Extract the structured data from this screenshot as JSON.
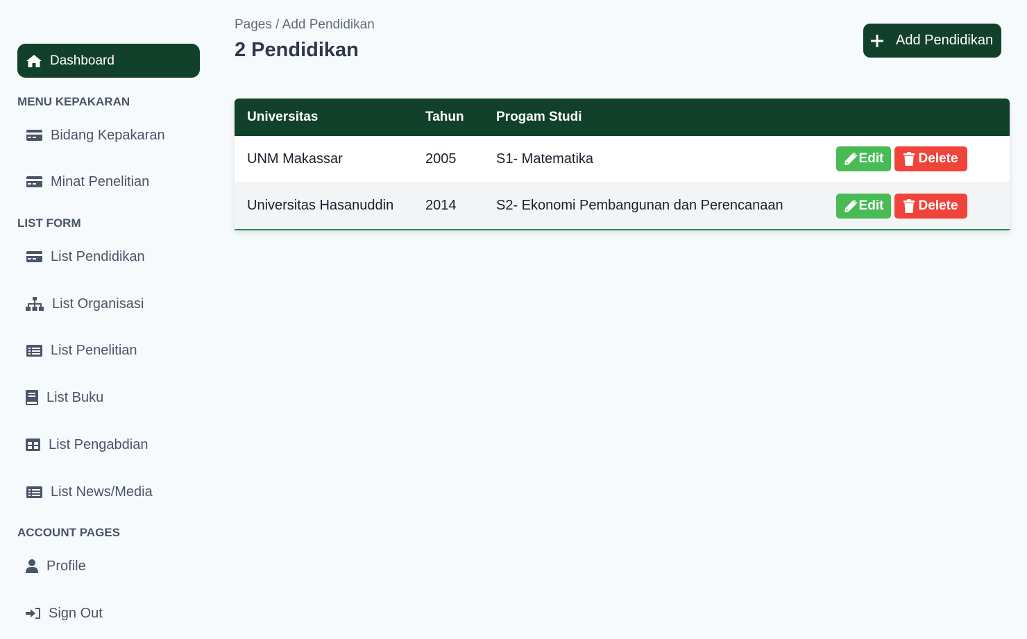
{
  "sidebar": {
    "active": {
      "label": "Dashboard",
      "icon": "home-icon"
    },
    "sections": [
      {
        "title": "MENU KEPAKARAN",
        "items": [
          {
            "label": "Bidang Kepakaran",
            "icon": "credit-card-icon"
          },
          {
            "label": "Minat Penelitian",
            "icon": "credit-card-icon"
          }
        ]
      },
      {
        "title": "LIST FORM",
        "items": [
          {
            "label": "List Pendidikan",
            "icon": "credit-card-icon"
          },
          {
            "label": "List Organisasi",
            "icon": "sitemap-icon"
          },
          {
            "label": "List Penelitian",
            "icon": "list-alt-icon"
          },
          {
            "label": "List Buku",
            "icon": "book-icon"
          },
          {
            "label": "List Pengabdian",
            "icon": "table-icon"
          },
          {
            "label": "List News/Media",
            "icon": "list-alt-icon"
          }
        ]
      },
      {
        "title": "ACCOUNT PAGES",
        "items": [
          {
            "label": "Profile",
            "icon": "user-icon"
          },
          {
            "label": "Sign Out",
            "icon": "sign-in-icon"
          }
        ]
      }
    ]
  },
  "header": {
    "breadcrumb": "Pages / Add Pendidikan",
    "title": "2 Pendidikan",
    "add_button_label": "Add Pendidikan"
  },
  "table": {
    "columns": [
      "Universitas",
      "Tahun",
      "Progam Studi",
      ""
    ],
    "rows": [
      {
        "universitas": "UNM Makassar",
        "tahun": "2005",
        "prodi": "S1- Matematika"
      },
      {
        "universitas": "Universitas Hasanuddin",
        "tahun": "2014",
        "prodi": "S2- Ekonomi Pembangunan dan Perencanaan"
      }
    ],
    "edit_label": "Edit",
    "delete_label": "Delete"
  },
  "colors": {
    "primary": "#12412b",
    "edit": "#48bb55",
    "delete": "#f0433a",
    "background": "#f7fafc"
  }
}
